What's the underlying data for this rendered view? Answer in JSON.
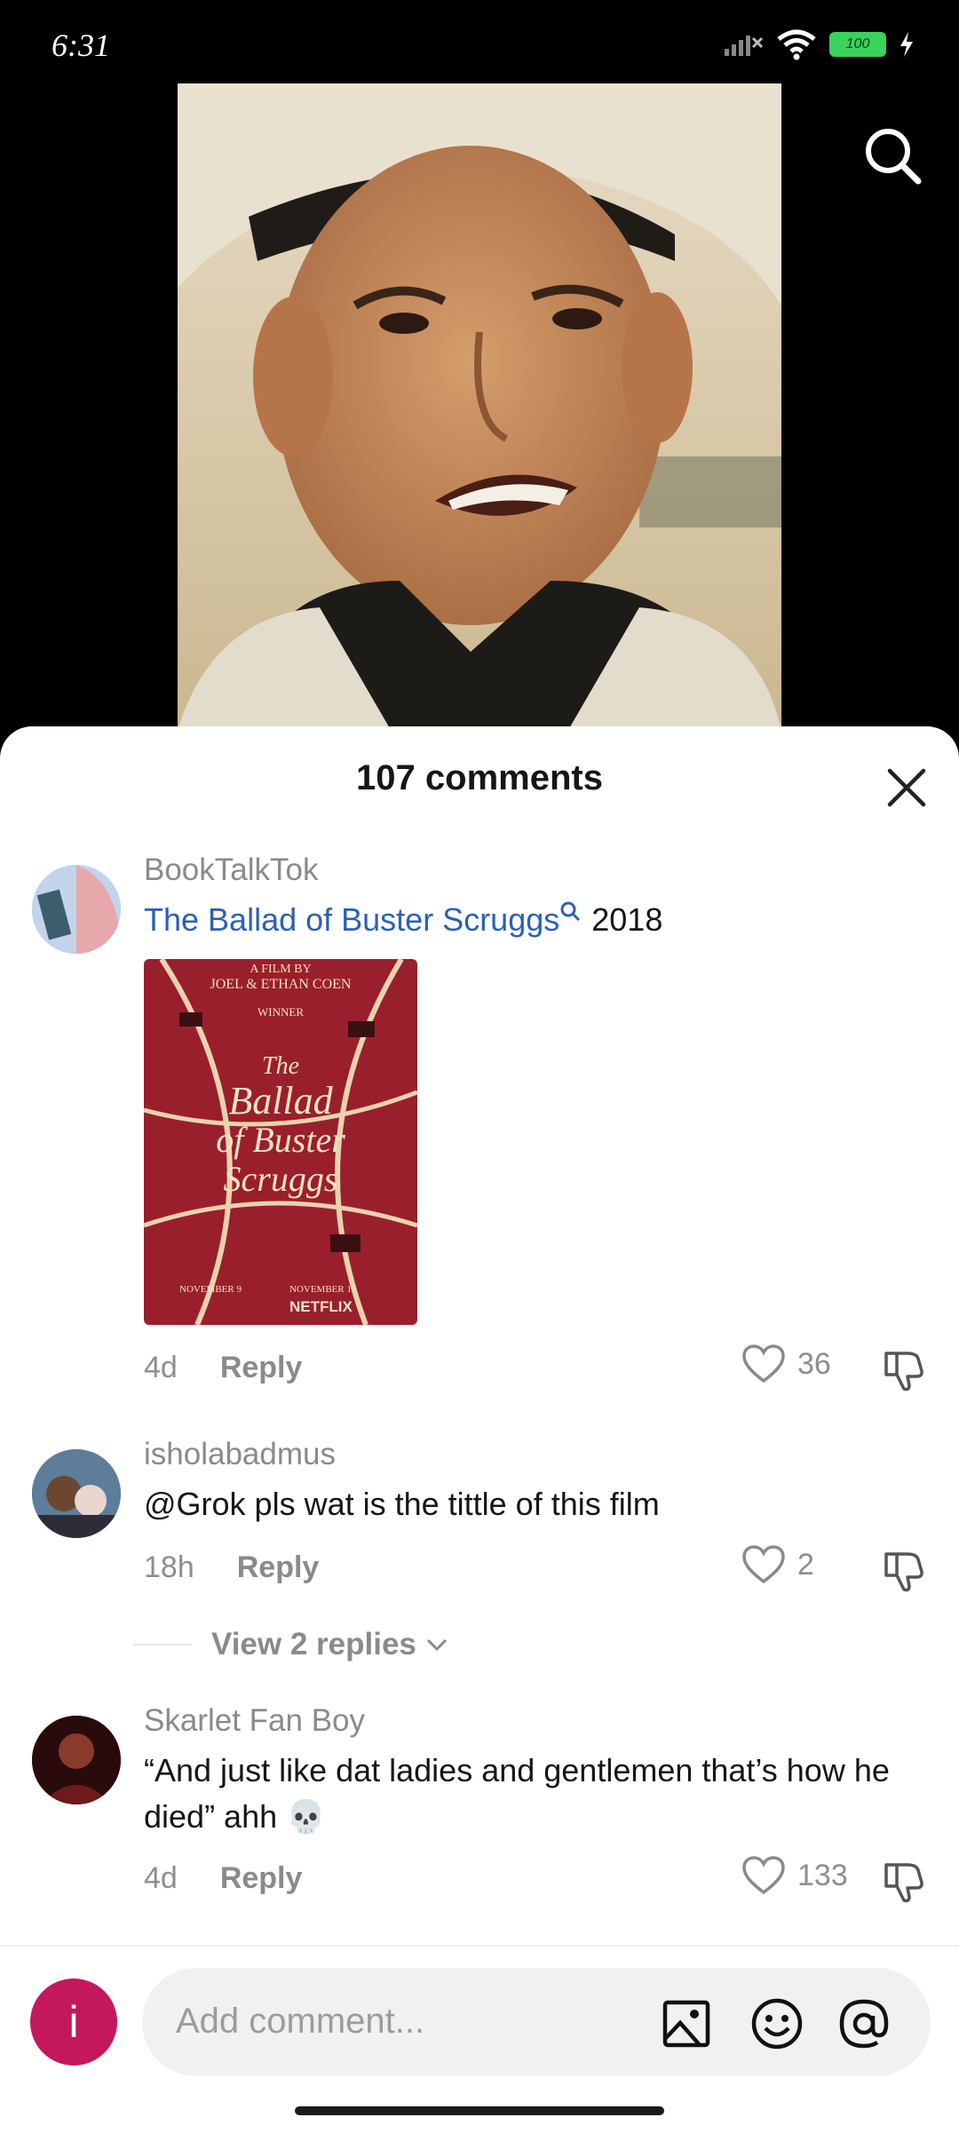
{
  "status": {
    "time": "6:31",
    "battery": "100"
  },
  "sheet": {
    "title": "107 comments"
  },
  "comments": [
    {
      "user": "BookTalkTok",
      "link_text": "The Ballad of Buster Scruggs",
      "after_link": " 2018",
      "poster": {
        "line1": "A FILM BY",
        "line2": "JOEL & ETHAN COEN",
        "badge": "WINNER",
        "title1": "The",
        "title2": "Ballad",
        "title3": "of Buster",
        "title4": "Scruggs",
        "left_note": "NOVEMBER 9",
        "right_note": "NOVEMBER 16",
        "brand": "NETFLIX"
      },
      "age": "4d",
      "reply": "Reply",
      "likes": "36"
    },
    {
      "user": "isholabadmus",
      "text": "@Grok pls wat is the tittle of this film",
      "age": "18h",
      "reply": "Reply",
      "likes": "2",
      "view_replies": "View 2 replies"
    },
    {
      "user": "Skarlet Fan Boy",
      "text": "“And just like dat ladies and gentlemen that’s how he died” ahh 💀",
      "age": "4d",
      "reply": "Reply",
      "likes": "133"
    }
  ],
  "input": {
    "placeholder": "Add comment...",
    "avatar_letter": "i"
  }
}
